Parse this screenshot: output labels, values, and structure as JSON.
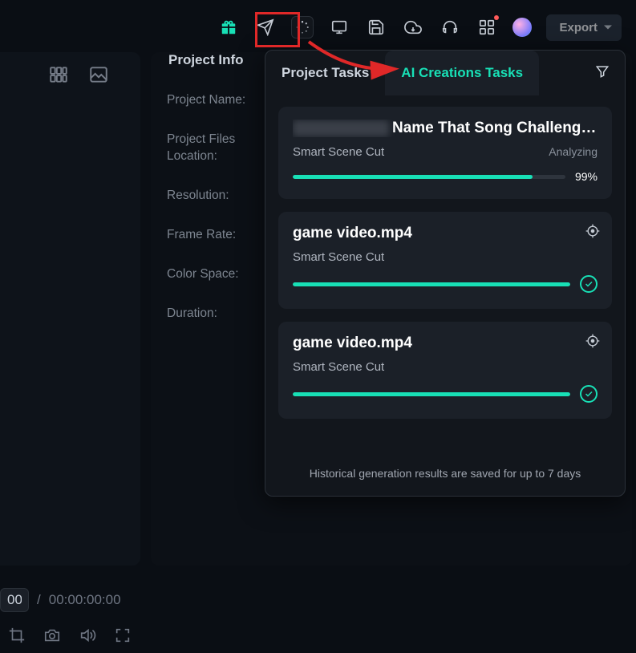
{
  "toolbar": {
    "export_label": "Export"
  },
  "tabs": {
    "project_tasks": "Project Tasks",
    "ai_creations_tasks": "AI Creations Tasks"
  },
  "project_info": {
    "heading": "Project Info",
    "fields": {
      "name": "Project Name:",
      "location": "Project Files Location:",
      "resolution": "Resolution:",
      "frame_rate": "Frame Rate:",
      "color_space": "Color Space:",
      "duration": "Duration:"
    }
  },
  "tasks": [
    {
      "title_suffix": "Name That Song Challeng…",
      "subtitle": "Smart Scene Cut",
      "status_text": "Analyzing",
      "progress_pct": 99,
      "progress_label": "99%",
      "state": "analyzing",
      "has_blurred_prefix": true
    },
    {
      "title": "game video.mp4",
      "subtitle": "Smart Scene Cut",
      "progress_pct": 100,
      "state": "complete"
    },
    {
      "title": "game video.mp4",
      "subtitle": "Smart Scene Cut",
      "progress_pct": 100,
      "state": "complete"
    }
  ],
  "tasks_footer": "Historical generation results are saved for up to 7 days",
  "timeline": {
    "current_fragment": "00",
    "separator": "/",
    "duration": "00:00:00:00"
  },
  "colors": {
    "accent": "#18e0b6",
    "highlight": "#e02828"
  }
}
